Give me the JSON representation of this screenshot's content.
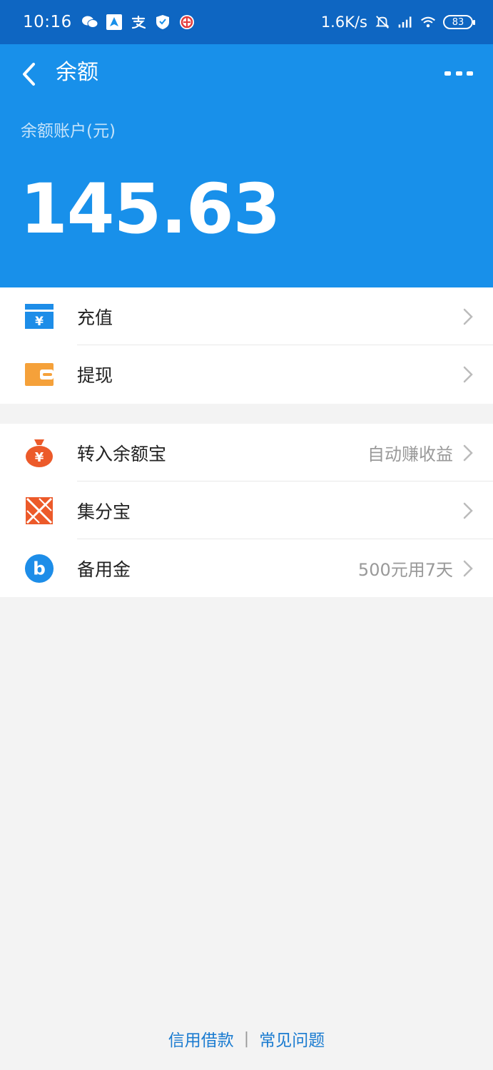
{
  "status_bar": {
    "time": "10:16",
    "net_speed": "1.6K/s",
    "battery": "83"
  },
  "header": {
    "title": "余额",
    "account_label": "余额账户(元)",
    "balance": "145.63"
  },
  "group1": [
    {
      "label": "充值",
      "icon": "recharge-icon",
      "extra": ""
    },
    {
      "label": "提现",
      "icon": "wallet-icon",
      "extra": ""
    }
  ],
  "group2": [
    {
      "label": "转入余额宝",
      "icon": "money-bag-icon",
      "extra": "自动赚收益"
    },
    {
      "label": "集分宝",
      "icon": "jifenbao-icon",
      "extra": ""
    },
    {
      "label": "备用金",
      "icon": "beiyongjin-icon",
      "extra": "500元用7天"
    }
  ],
  "footer": {
    "link1": "信用借款",
    "separator": "|",
    "link2": "常见问题"
  },
  "colors": {
    "header_bg": "#1890ea",
    "statusbar_bg": "#0e66c2",
    "link": "#1a7bd0"
  }
}
